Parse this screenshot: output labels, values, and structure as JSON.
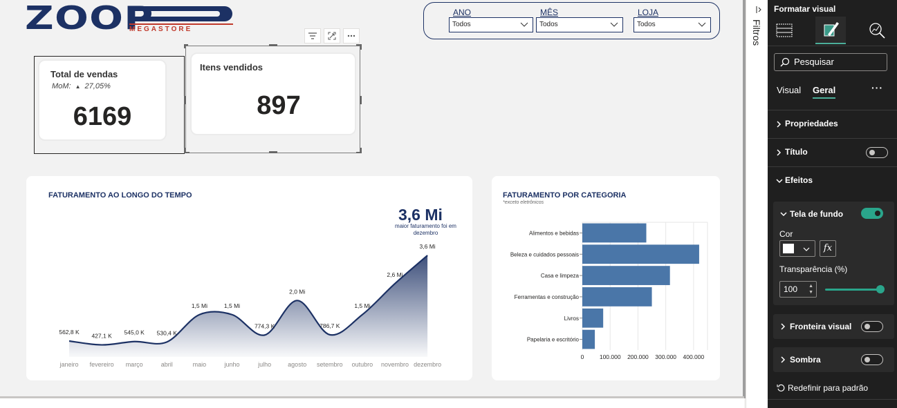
{
  "logo": {
    "brand": "ZOOP",
    "sub": "MEGASTORE"
  },
  "filters": [
    {
      "label": "ANO",
      "value": "Todos"
    },
    {
      "label": "MÊS",
      "value": "Todos"
    },
    {
      "label": "LOJA",
      "value": "Todos"
    }
  ],
  "kpis": {
    "total_vendas": {
      "title": "Total de vendas",
      "mom_label": "MoM:",
      "mom_value": "27,05%",
      "mom_arrow": "▲",
      "value": "6169"
    },
    "itens_vendidos": {
      "title": "Itens vendidos",
      "value": "897"
    }
  },
  "line_chart_card": {
    "title": "FATURAMENTO AO LONGO DO TEMPO",
    "highlight_value": "3,6 Mi",
    "highlight_note": "maior faturamento foi em dezembro"
  },
  "bar_chart_card": {
    "title": "FATURAMENTO POR CATEGORIA",
    "subtitle": "*exceto eletrônicos"
  },
  "chart_data": [
    {
      "type": "area",
      "title": "FATURAMENTO AO LONGO DO TEMPO",
      "categories": [
        "janeiro",
        "fevereiro",
        "março",
        "abril",
        "maio",
        "junho",
        "julho",
        "agosto",
        "setembro",
        "outubro",
        "novembro",
        "dezembro"
      ],
      "values": [
        562800,
        427100,
        545000,
        530400,
        1500000,
        1500000,
        774300,
        2000000,
        786700,
        1500000,
        2600000,
        3600000
      ],
      "data_labels": [
        "562,8 K",
        "427,1 K",
        "545,0 K",
        "530,4 K",
        "1,5 Mi",
        "1,5 Mi",
        "774,3 K",
        "2,0 Mi",
        "786,7 K",
        "1,5 Mi",
        "2,6 Mi",
        "3,6 Mi"
      ],
      "color": "#1c3164"
    },
    {
      "type": "bar",
      "orientation": "horizontal",
      "title": "FATURAMENTO POR CATEGORIA",
      "categories": [
        "Alimentos e bebidas",
        "Beleza e cuidados pessoais",
        "Casa e limpeza",
        "Ferramentas e construção",
        "Livros",
        "Papelaria e escritório"
      ],
      "values": [
        230000,
        420000,
        315000,
        250000,
        75000,
        45000
      ],
      "xlim": [
        0,
        450000
      ],
      "x_ticks": [
        "0",
        "100.000",
        "200.000",
        "300.000",
        "400.000"
      ],
      "color": "#4a76a8",
      "grid": true
    }
  ],
  "filtros_pane": {
    "label": "Filtros"
  },
  "format_pane": {
    "title": "Formatar visual",
    "search_placeholder": "Pesquisar",
    "subtabs": {
      "visual": "Visual",
      "geral": "Geral",
      "more": "···"
    },
    "sections": {
      "propriedades": "Propriedades",
      "titulo": "Título",
      "efeitos": "Efeitos"
    },
    "tela_de_fundo": {
      "label": "Tela de fundo",
      "cor_label": "Cor",
      "fx": "fx",
      "transparencia_label": "Transparência (%)",
      "transparencia_value": "100"
    },
    "fronteira_visual": "Fronteira visual",
    "sombra": "Sombra",
    "reset": "Redefinir para padrão",
    "toggles": {
      "titulo": false,
      "tela_de_fundo": true,
      "fronteira_visual": false,
      "sombra": false
    }
  }
}
